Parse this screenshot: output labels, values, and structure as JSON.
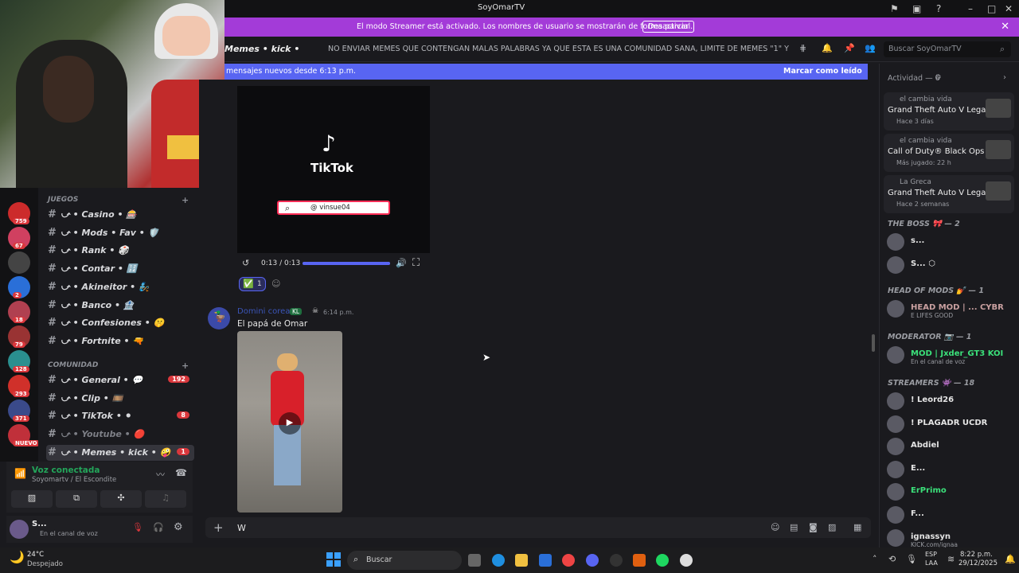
{
  "window": {
    "title": "SoyOmarTV"
  },
  "streamer_banner": {
    "message": "El modo Streamer está activado. Los nombres de usuario se mostrarán de forma parcial.",
    "button": "Desactivar"
  },
  "channel_header": {
    "name": "Memes • kick •",
    "topic": "NO ENVIAR MEMES QUE CONTENGAN MALAS PALABRAS YA QUE ESTA ES UNA COMUNIDAD SANA, LIMITE DE MEMES \"1\" Y POR ULTIMO E...",
    "search_placeholder": "Buscar SoyOmarTV"
  },
  "new_messages": {
    "text": "mensajes nuevos desde 6:13 p.m.",
    "action": "Marcar como leído"
  },
  "servers": [
    {
      "badge": "759"
    },
    {
      "badge": "67"
    },
    {
      "badge": ""
    },
    {
      "badge": "2"
    },
    {
      "badge": "18"
    },
    {
      "badge": "79"
    },
    {
      "badge": "128"
    },
    {
      "badge": "293"
    },
    {
      "badge": "371"
    },
    {
      "badge": "NUEVO"
    }
  ],
  "categories": [
    {
      "label": "JUEGOS"
    },
    {
      "label": "COMUNIDAD"
    }
  ],
  "channels_juegos": [
    {
      "label": "⤻ • Casino • 🎰",
      "count": ""
    },
    {
      "label": "⤻ • Mods • Fav • 🛡️",
      "count": ""
    },
    {
      "label": "⤻ • Rank • 🎲",
      "count": ""
    },
    {
      "label": "⤻ • Contar • 🔢",
      "count": ""
    },
    {
      "label": "⤻ • Akineitor • 🧞",
      "count": ""
    },
    {
      "label": "⤻ • Banco • 🏦",
      "count": ""
    },
    {
      "label": "⤻ • Confesiones • 🤫",
      "count": ""
    },
    {
      "label": "⤻ • Fortnite • 🔫",
      "count": ""
    }
  ],
  "channels_comunidad": [
    {
      "label": "⤻ • General • 💬",
      "count": "192"
    },
    {
      "label": "⤻ • Clip • 🎞️",
      "count": ""
    },
    {
      "label": "⤻ • TikTok • ⚫",
      "count": "8"
    },
    {
      "label": "⤻ • Youtube • 🔴",
      "count": ""
    },
    {
      "label": "⤻ • Memes • kick • 🤪",
      "count": "1"
    }
  ],
  "voice": {
    "status": "Voz conectada",
    "location": "Soyomartv / El Escondite"
  },
  "user": {
    "name": "S...",
    "status": "En el canal de voz"
  },
  "tiktok_embed": {
    "brand": "TikTok",
    "handle": "@ vinsue04",
    "time": "0:13 / 0:13",
    "progress": 1.0,
    "reaction_count": "1"
  },
  "message": {
    "author": "Domini corea",
    "tag": "KL",
    "time": "6:14 p.m.",
    "text": "El papá de Omar"
  },
  "composer": {
    "value": "W"
  },
  "activity": {
    "header": "Actividad — 6",
    "cards": [
      {
        "who": "el cambia vida",
        "game": "Grand Theft Auto V Legacy",
        "when": "Hace 3 días"
      },
      {
        "who": "el cambia vida",
        "game": "Call of Duty® Black Ops 7",
        "when": "Más jugado: 22 h"
      },
      {
        "who": "La Greca",
        "game": "Grand Theft Auto V Legacy",
        "when": "Hace 2 semanas"
      }
    ]
  },
  "member_groups": [
    {
      "header": "THE BOSS 🎀 — 2",
      "members": [
        {
          "name": "s...",
          "status": ""
        },
        {
          "name": "S... ⬡",
          "status": ""
        }
      ]
    },
    {
      "header": "HEAD OF MODS 💅 — 1",
      "members": [
        {
          "name": "HEAD MOD | ...  CYBR",
          "status": "E LIFES GOOD"
        }
      ]
    },
    {
      "header": "MODERATOR 📷 — 1",
      "members": [
        {
          "name": "MOD | Jxder_GT3  KOI",
          "status": "En el canal de voz"
        }
      ]
    },
    {
      "header": "STREAMERS 👾 — 18",
      "members": [
        {
          "name": "! Leord26",
          "status": ""
        },
        {
          "name": "! PLAGADR  UCDR",
          "status": ""
        },
        {
          "name": "Abdiel",
          "status": ""
        },
        {
          "name": "E...",
          "status": ""
        },
        {
          "name": "ErPrimo",
          "status": ""
        },
        {
          "name": "F...",
          "status": ""
        },
        {
          "name": "ignassyn",
          "status": "KICK.com/ignaa"
        }
      ]
    }
  ],
  "taskbar": {
    "weather_temp": "24°C",
    "weather_desc": "Despejado",
    "search": "Buscar",
    "lang": "ESP",
    "lang2": "LAA",
    "time": "8:22 p.m.",
    "date": "29/12/2025"
  },
  "colors": {
    "accent": "#5865f2",
    "streamer": "#a33bd8",
    "badge": "#da373c",
    "voice_green": "#23a55a"
  }
}
